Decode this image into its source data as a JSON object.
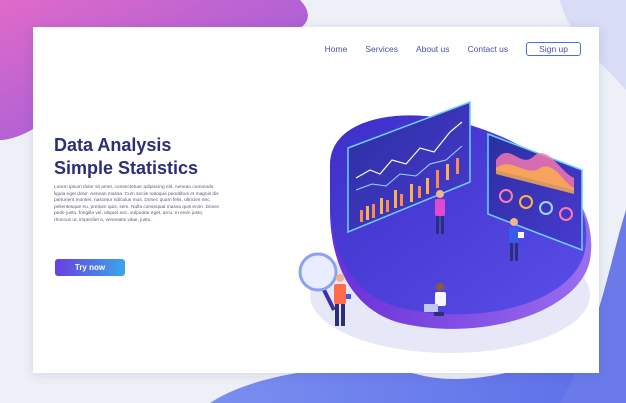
{
  "nav": {
    "home": "Home",
    "services": "Services",
    "about": "About us",
    "contact": "Contact us",
    "signup": "Sign up"
  },
  "hero": {
    "title_line1": "Data Analysis",
    "title_line2": "Simple Statistics",
    "body": "Lorem ipsum dolor sit amet, consectetuer adipiscing elit. Aenean commodo ligula eget dolor. Aenean massa. Cum sociis natoque penatibus et magnis dis parturient montes, nascetur ridiculus mus. Donec quam felis, ultricies nec, pellentesque eu, pretium quis, sem. Nulla consequat massa quis enim. Donec pede justo, fringilla vel, aliquet nec, vulputate eget, arcu. In enim justo, rhoncus ut, imperdiet a, venenatis vitae, justo.",
    "cta": "Try now"
  },
  "colors": {
    "title": "#2c2e7a",
    "nav": "#4a4fa8",
    "accent_start": "#6a3fe0",
    "accent_end": "#3aa6ea",
    "platform": "#4f3fd8"
  },
  "icons": [
    "magnifier-icon",
    "dashboard-screen",
    "people-figures"
  ]
}
